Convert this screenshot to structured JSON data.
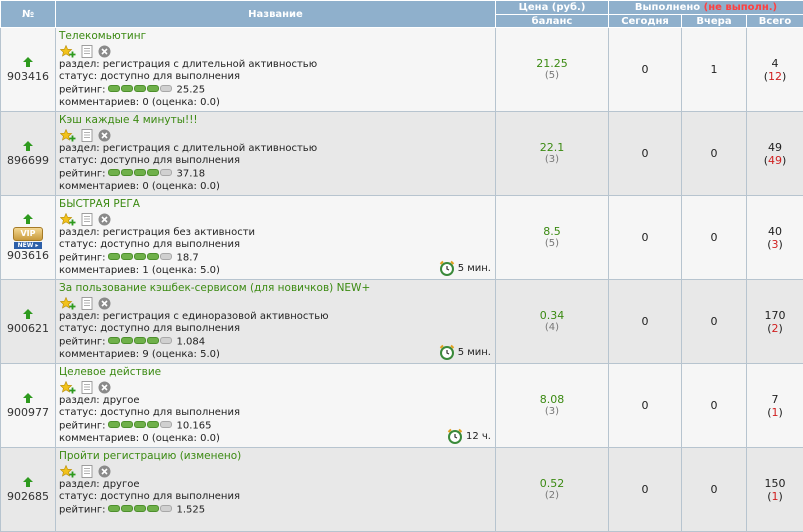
{
  "header": {
    "num": "№",
    "name": "Название",
    "price": "Цена (руб.)",
    "balance": "баланс",
    "done": "Выполнено",
    "notdone": "(не выполн.)",
    "today": "Сегодня",
    "yesterday": "Вчера",
    "total": "Всего"
  },
  "tasks": [
    {
      "id": "903416",
      "title": "Телекомьютинг",
      "section": "раздел: регистрация с длительной активностью",
      "status": "статус: доступно для выполнения",
      "rating_label": "рейтинг:",
      "rating": "25.25",
      "rating_level": 4,
      "comments": "комментариев: 0 (оценка: 0.0)",
      "timer": "",
      "price": "21.25",
      "balance": "(5)",
      "today": "0",
      "yesterday": "1",
      "total": "4",
      "fail_open": "(",
      "fail": "12",
      "fail_close": ")",
      "vip": false
    },
    {
      "id": "896699",
      "title": "Кэш каждые 4 минуты!!!",
      "section": "раздел: регистрация с длительной активностью",
      "status": "статус: доступно для выполнения",
      "rating_label": "рейтинг:",
      "rating": "37.18",
      "rating_level": 4,
      "comments": "комментариев: 0 (оценка: 0.0)",
      "timer": "",
      "price": "22.1",
      "balance": "(3)",
      "today": "0",
      "yesterday": "0",
      "total": "49",
      "fail_open": "(",
      "fail": "49",
      "fail_close": ")",
      "vip": false
    },
    {
      "id": "903616",
      "title": "БЫСТРАЯ РЕГА",
      "section": "раздел: регистрация без активности",
      "status": "статус: доступно для выполнения",
      "rating_label": "рейтинг:",
      "rating": "18.7",
      "rating_level": 4,
      "comments": "комментариев: 1 (оценка: 5.0)",
      "timer": "5 мин.",
      "price": "8.5",
      "balance": "(5)",
      "today": "0",
      "yesterday": "0",
      "total": "40",
      "fail_open": "(",
      "fail": "3",
      "fail_close": ")",
      "vip": true,
      "vip_label": "VIP",
      "new_label": "NEW ▸"
    },
    {
      "id": "900621",
      "title": "За пользование кэшбек-сервисом (для новичков) NEW+",
      "section": "раздел: регистрация с единоразовой активностью",
      "status": "статус: доступно для выполнения",
      "rating_label": "рейтинг:",
      "rating": "1.084",
      "rating_level": 4,
      "comments": "комментариев: 9 (оценка: 5.0)",
      "timer": "5 мин.",
      "price": "0.34",
      "balance": "(4)",
      "today": "0",
      "yesterday": "0",
      "total": "170",
      "fail_open": "(",
      "fail": "2",
      "fail_close": ")",
      "vip": false
    },
    {
      "id": "900977",
      "title": "Целевое действие",
      "section": "раздел: другое",
      "status": "статус: доступно для выполнения",
      "rating_label": "рейтинг:",
      "rating": "10.165",
      "rating_level": 4,
      "comments": "комментариев: 0 (оценка: 0.0)",
      "timer": "12 ч.",
      "price": "8.08",
      "balance": "(3)",
      "today": "0",
      "yesterday": "0",
      "total": "7",
      "fail_open": "(",
      "fail": "1",
      "fail_close": ")",
      "vip": false
    },
    {
      "id": "902685",
      "title": "Пройти регистрацию (изменено)",
      "section": "раздел: другое",
      "status": "статус: доступно для выполнения",
      "rating_label": "рейтинг:",
      "rating": "1.525",
      "rating_level": 4,
      "comments": "",
      "timer": "",
      "price": "0.52",
      "balance": "(2)",
      "today": "0",
      "yesterday": "0",
      "total": "150",
      "fail_open": "(",
      "fail": "1",
      "fail_close": ")",
      "vip": false
    }
  ],
  "colors": {
    "header_bg": "#8fb0cc",
    "link_green": "#3b8a12",
    "fail_red": "#d02020"
  },
  "icons": [
    "green-up-arrow-icon",
    "star-add-favorite-icon",
    "document-icon",
    "close-circle-icon",
    "alarm-clock-icon"
  ]
}
